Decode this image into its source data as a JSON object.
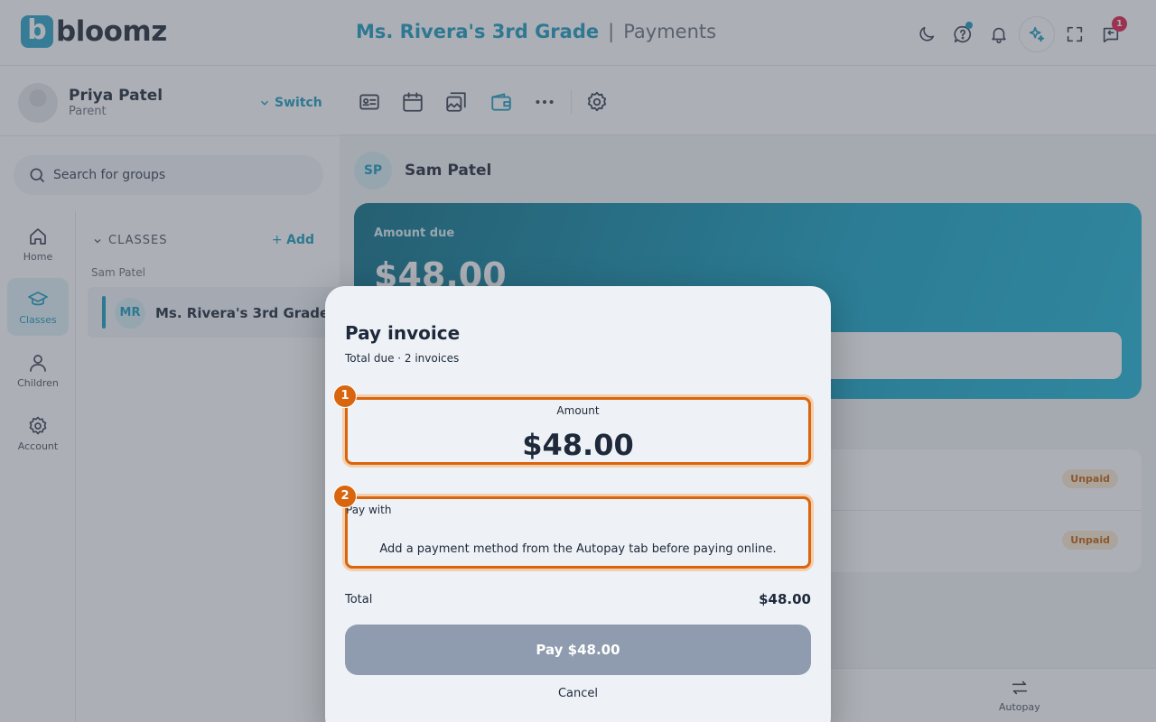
{
  "app": {
    "logo_text": "bloomz",
    "logo_mark": "b"
  },
  "header": {
    "class_name": "Ms. Rivera's 3rd Grade",
    "separator": "|",
    "section": "Payments",
    "messages_badge": "1"
  },
  "profile": {
    "name": "Priya Patel",
    "role": "Parent",
    "switch_label": "Switch"
  },
  "search": {
    "placeholder": "Search for groups"
  },
  "rail": {
    "items": [
      {
        "label": "Home",
        "icon": "home-icon"
      },
      {
        "label": "Classes",
        "icon": "graduation-cap-icon"
      },
      {
        "label": "Children",
        "icon": "person-icon"
      },
      {
        "label": "Account",
        "icon": "gear-icon"
      }
    ]
  },
  "groups": {
    "heading": "CLASSES",
    "add_label": "Add",
    "child_name": "Sam Patel",
    "class_initials": "MR",
    "class_name": "Ms. Rivera's 3rd Grade"
  },
  "student": {
    "initials": "SP",
    "name": "Sam Patel"
  },
  "due_card": {
    "label": "Amount due",
    "value": "$48.00"
  },
  "invoices": [
    {
      "status": "Unpaid"
    },
    {
      "status": "Unpaid"
    }
  ],
  "bottom_nav": {
    "autopay_label": "Autopay"
  },
  "modal": {
    "title": "Pay invoice",
    "subtitle": "Total due · 2 invoices",
    "amount_label": "Amount",
    "amount_value": "$48.00",
    "pay_with_label": "Pay with",
    "pay_with_message": "Add a payment method from the Autopay tab before paying online.",
    "total_label": "Total",
    "total_value": "$48.00",
    "pay_button": "Pay $48.00",
    "cancel_button": "Cancel",
    "marker_1": "1",
    "marker_2": "2"
  },
  "colors": {
    "accent": "#1a9bbf",
    "highlight": "#d9650e",
    "pay_button": "#8f9bae",
    "unpaid_pill": "#fdebd3"
  }
}
